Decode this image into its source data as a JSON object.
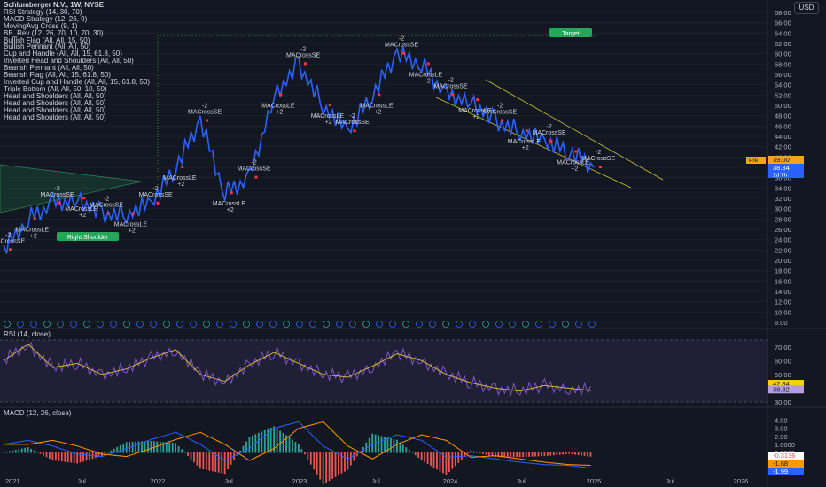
{
  "header": {
    "title": "Schlumberger N.V., 1W, NYSE",
    "currency": "USD",
    "indicators": [
      "RSI Strategy (14, 30, 70)",
      "MACD Strategy (12, 26, 9)",
      "MovingAvg Cross (9, 1)",
      "BB_Rev (12, 26, 70, 10, 70, 30)",
      "Bullish Flag (All, All, 15, 50)",
      "Bullish Pennant (All, All, 50)",
      "Cup and Handle (All, All, 15, 61.8, 50)",
      "Inverted Head and Shoulders (All, All, 50)",
      "Bearish Pennant (All, All, 50)",
      "Bearish Flag (All, All, 15, 61.8, 50)",
      "Inverted Cup and Handle (All, All, 15, 61.8, 50)",
      "Triple Bottom (All, All, 50, 10, 50)",
      "Head and Shoulders (All, All, 50)",
      "Head and Shoulders (All, All, 50)",
      "Head and Shoulders (All, All, 50)",
      "Head and Shoulders (All, All, 50)"
    ]
  },
  "price_axis": {
    "labels": [
      "68.00",
      "66.00",
      "64.00",
      "62.00",
      "60.00",
      "58.00",
      "56.00",
      "54.00",
      "52.00",
      "50.00",
      "48.00",
      "46.00",
      "44.00",
      "42.00",
      "40.00",
      "38.00",
      "36.00",
      "34.00",
      "32.00",
      "30.00",
      "28.00",
      "26.00",
      "24.00",
      "22.00",
      "20.00",
      "18.00",
      "16.00",
      "14.00",
      "12.00",
      "10.00",
      "8.00"
    ],
    "tags": {
      "pre_label": "Pre",
      "pre_price": "39.00",
      "last_price": "38.34",
      "countdown": "1d 7h"
    }
  },
  "rsi": {
    "title": "RSI (14, close)",
    "axis": [
      "70.00",
      "60.00",
      "50.00",
      "40.00",
      "30.00"
    ],
    "tags": [
      "42.84",
      "38.82"
    ]
  },
  "macd": {
    "title": "MACD (12, 26, close)",
    "axis": [
      "4.00",
      "3.00",
      "2.00",
      "1.0000",
      "0.0000",
      "-1.0000",
      "-2.00"
    ],
    "tags": [
      "-0.3136",
      "-1.68",
      "-1.99"
    ]
  },
  "time_axis": [
    "2021",
    "Jul",
    "2022",
    "Jul",
    "2023",
    "Jul",
    "2024",
    "Jul",
    "2025",
    "Jul",
    "2026"
  ],
  "annotations": {
    "target": "Target",
    "right_shoulder": "Right Shoulder",
    "ma_cross_se": "MACrossSE",
    "ma_cross_le": "MACrossLE",
    "plus2": "+2",
    "minus2": "-2"
  },
  "chart_data": {
    "type": "line",
    "title": "Schlumberger N.V., 1W, NYSE",
    "xlabel": "",
    "ylabel": "",
    "x": [
      "2021-01",
      "2021-03",
      "2021-05",
      "2021-07",
      "2021-09",
      "2021-11",
      "2022-01",
      "2022-03",
      "2022-05",
      "2022-07",
      "2022-09",
      "2022-11",
      "2023-01",
      "2023-03",
      "2023-05",
      "2023-07",
      "2023-09",
      "2023-11",
      "2024-01",
      "2024-03",
      "2024-05",
      "2024-07",
      "2024-09",
      "2024-11",
      "2024-12"
    ],
    "series": [
      {
        "values": [
          22,
          28,
          31,
          32,
          29,
          29,
          31,
          38,
          47,
          33,
          36,
          52,
          58,
          50,
          45,
          52,
          60,
          58,
          52,
          51,
          47,
          45,
          43,
          41,
          38
        ]
      }
    ],
    "ylim": [
      7,
      70
    ],
    "target_level": 64.5,
    "rsi_series": {
      "values": [
        60,
        72,
        55,
        58,
        50,
        54,
        62,
        68,
        50,
        45,
        57,
        66,
        58,
        50,
        48,
        56,
        65,
        60,
        50,
        44,
        40,
        38,
        42,
        40,
        38
      ],
      "ylim": [
        30,
        75
      ]
    },
    "macd_series": {
      "values": [
        1.0,
        1.5,
        0.8,
        -0.2,
        -0.5,
        0.5,
        1.6,
        2.5,
        1.0,
        -1.0,
        0.5,
        3.0,
        3.8,
        0.8,
        -0.8,
        1.0,
        2.2,
        1.5,
        -0.6,
        -0.4,
        -0.8,
        -1.2,
        -1.5,
        -1.6,
        -1.99
      ],
      "ylim": [
        -2.3,
        4.5
      ]
    }
  }
}
